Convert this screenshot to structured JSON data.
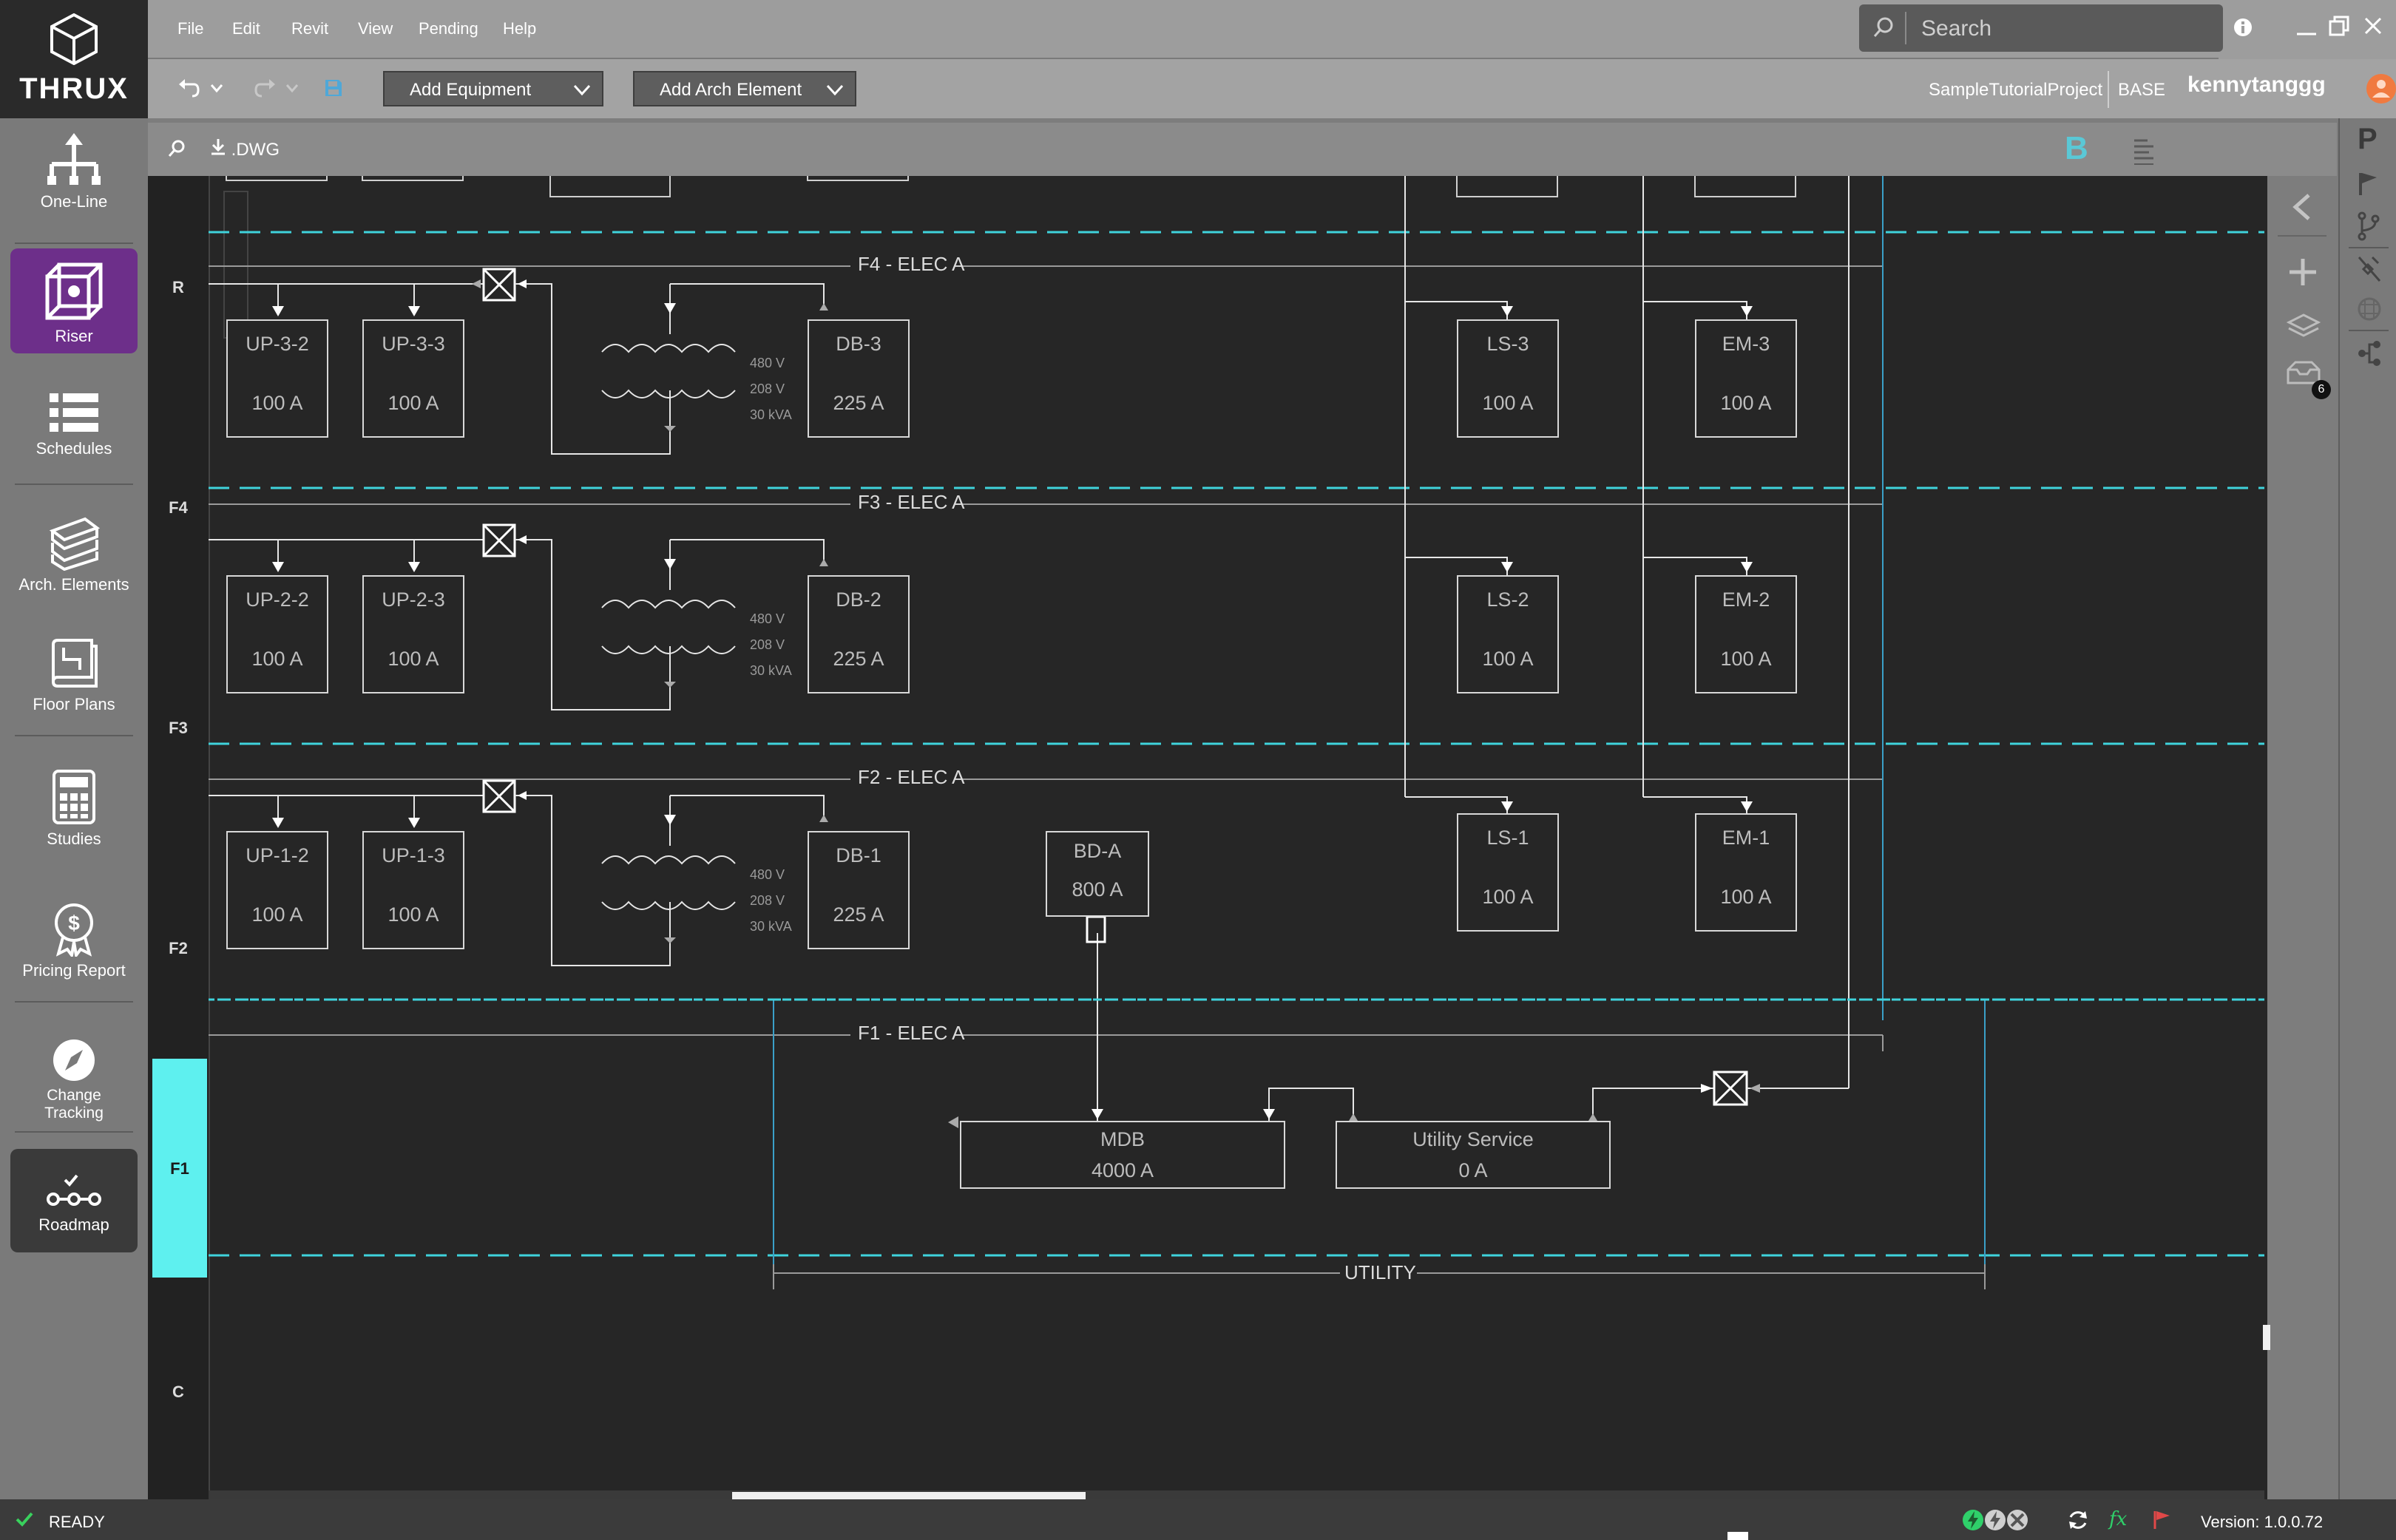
{
  "app": {
    "brand": "THRUX"
  },
  "nav": {
    "items": [
      "One-Line",
      "Riser",
      "Schedules",
      "Arch. Elements",
      "Floor Plans",
      "Studies",
      "Pricing Report",
      "Change Tracking",
      "Roadmap"
    ],
    "active": "Riser"
  },
  "menu": {
    "file": "File",
    "edit": "Edit",
    "revit": "Revit",
    "view": "View",
    "pending": "Pending",
    "help": "Help"
  },
  "toolbar": {
    "add_equipment": "Add Equipment",
    "add_arch_element": "Add Arch Element"
  },
  "search": {
    "placeholder": "Search"
  },
  "header": {
    "project": "SampleTutorialProject",
    "base": "BASE",
    "user": "kennytanggg"
  },
  "canvas": {
    "dwg": ".DWG",
    "b_label": "B",
    "notification_count": "6"
  },
  "levels": {
    "r": "R",
    "f4": "F4",
    "f3": "F3",
    "f2": "F2",
    "f1": "F1",
    "c": "C"
  },
  "buses": {
    "f4": "F4 - ELEC A",
    "f3": "F3 - ELEC A",
    "f2": "F2 - ELEC A",
    "f1": "F1 - ELEC A",
    "utility": "UTILITY"
  },
  "transformer": {
    "primary": "480 V",
    "secondary": "208 V",
    "rating": "30 kVA"
  },
  "equipment": {
    "up32": {
      "name": "UP-3-2",
      "rating": "100 A"
    },
    "up33": {
      "name": "UP-3-3",
      "rating": "100 A"
    },
    "db3": {
      "name": "DB-3",
      "rating": "225 A"
    },
    "ls3": {
      "name": "LS-3",
      "rating": "100 A"
    },
    "em3": {
      "name": "EM-3",
      "rating": "100 A"
    },
    "up22": {
      "name": "UP-2-2",
      "rating": "100 A"
    },
    "up23": {
      "name": "UP-2-3",
      "rating": "100 A"
    },
    "db2": {
      "name": "DB-2",
      "rating": "225 A"
    },
    "ls2": {
      "name": "LS-2",
      "rating": "100 A"
    },
    "em2": {
      "name": "EM-2",
      "rating": "100 A"
    },
    "up12": {
      "name": "UP-1-2",
      "rating": "100 A"
    },
    "up13": {
      "name": "UP-1-3",
      "rating": "100 A"
    },
    "db1": {
      "name": "DB-1",
      "rating": "225 A"
    },
    "bda": {
      "name": "BD-A",
      "rating": "800 A"
    },
    "ls1": {
      "name": "LS-1",
      "rating": "100 A"
    },
    "em1": {
      "name": "EM-1",
      "rating": "100 A"
    },
    "mdb": {
      "name": "MDB",
      "rating": "4000 A"
    },
    "utility": {
      "name": "Utility Service",
      "rating": "0 A"
    }
  },
  "status": {
    "ready": "READY",
    "version": "Version: 1.0.0.72"
  },
  "colors": {
    "accent": "#5ef0ef",
    "active_nav": "#6d2f8a",
    "canvas": "#262626",
    "dashed_line": "#3fd3dc"
  }
}
